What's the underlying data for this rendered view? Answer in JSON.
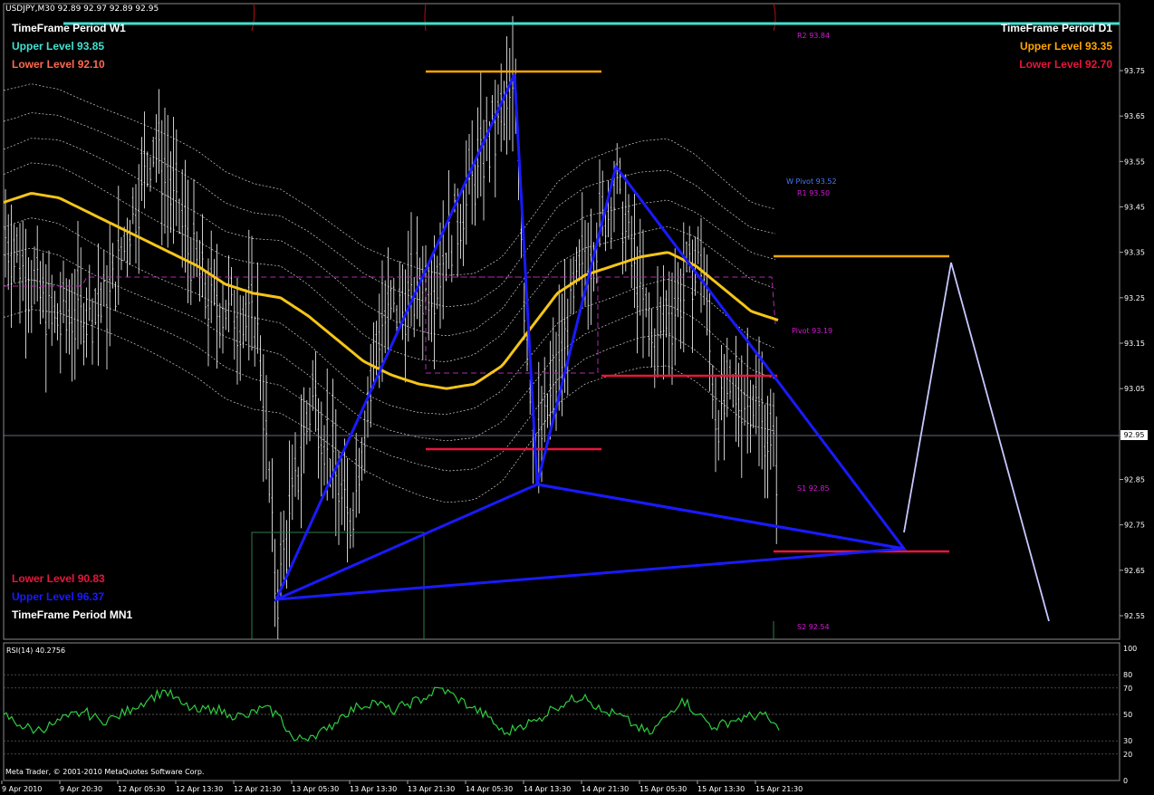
{
  "header": {
    "symbol_info": "USDJPY,M30  92.89 92.97 92.89 92.95"
  },
  "labels_left_top": {
    "tf_w1": "TimeFrame Period W1",
    "upper_w1": "Upper Level 93.85",
    "lower_w1": "Lower Level 92.10"
  },
  "labels_right_top": {
    "tf_d1": "TimeFrame Period D1",
    "upper_d1": "Upper Level 93.35",
    "lower_d1": "Lower Level 92.70"
  },
  "labels_left_bottom": {
    "lower_mn1": "Lower Level 90.83",
    "upper_mn1": "Upper Level 96.37",
    "tf_mn1": "TimeFrame Period MN1"
  },
  "pivots": {
    "r2": "R2 93.84",
    "w_pivot": "W Pivot 93.52",
    "r1": "R1 93.50",
    "pivot": "Pivot 93.19",
    "s1": "S1 92.85",
    "s2": "S2 92.54"
  },
  "price_axis": [
    "93.75",
    "93.65",
    "93.55",
    "93.45",
    "93.35",
    "93.25",
    "93.15",
    "93.05",
    "92.85",
    "92.75",
    "92.65",
    "92.55"
  ],
  "current_price": "92.95",
  "rsi": {
    "label": "RSI(14) 40.2756",
    "levels": [
      "100",
      "80",
      "70",
      "50",
      "30",
      "20",
      "0"
    ]
  },
  "copyright": "Meta Trader, © 2001-2010 MetaQuotes Software Corp.",
  "time_axis": [
    "9 Apr 2010",
    "9 Apr 20:30",
    "12 Apr 05:30",
    "12 Apr 13:30",
    "12 Apr 21:30",
    "13 Apr 05:30",
    "13 Apr 13:30",
    "13 Apr 21:30",
    "14 Apr 05:30",
    "14 Apr 13:30",
    "14 Apr 21:30",
    "15 Apr 05:30",
    "15 Apr 13:30",
    "15 Apr 21:30"
  ],
  "colors": {
    "background": "#000000",
    "candles": "#ffffff",
    "ma": "#f5c518",
    "bands": "#d0d0d0",
    "pattern": "#1a1aff",
    "upper_level_w1": "#40e0d0",
    "lower_level": "#e8163c",
    "upper_level_d1": "#ffa500",
    "pivot_text": "#d61ad6",
    "w_pivot_text": "#4a7bff",
    "rsi_line": "#2ecc40",
    "projection": "#c8c8ff"
  },
  "chart_data": {
    "type": "line",
    "title": "USDJPY,M30",
    "price_range": [
      92.49,
      93.87
    ],
    "moving_average": [
      93.46,
      93.48,
      93.47,
      93.44,
      93.41,
      93.38,
      93.35,
      93.32,
      93.28,
      93.26,
      93.25,
      93.21,
      93.16,
      93.11,
      93.08,
      93.06,
      93.05,
      93.06,
      93.1,
      93.18,
      93.26,
      93.3,
      93.32,
      93.34,
      93.35,
      93.32,
      93.27,
      93.22,
      93.2
    ],
    "pattern_points": [
      [
        92.59
      ],
      [
        93.74
      ],
      [
        92.84
      ],
      [
        93.53
      ],
      [
        92.7
      ]
    ],
    "projection_points": [
      [
        92.72
      ],
      [
        93.34
      ],
      [
        92.53
      ]
    ],
    "rsi_values": [
      50,
      42,
      38,
      42,
      48,
      52,
      45,
      48,
      55,
      62,
      68,
      58,
      52,
      55,
      50,
      48,
      55,
      50,
      30,
      34,
      38,
      50,
      56,
      60,
      52,
      58,
      62,
      70,
      63,
      55,
      48,
      35,
      42,
      45,
      55,
      60,
      65,
      52,
      50,
      42,
      35,
      48,
      62,
      50,
      40,
      45,
      48,
      50,
      38
    ]
  }
}
